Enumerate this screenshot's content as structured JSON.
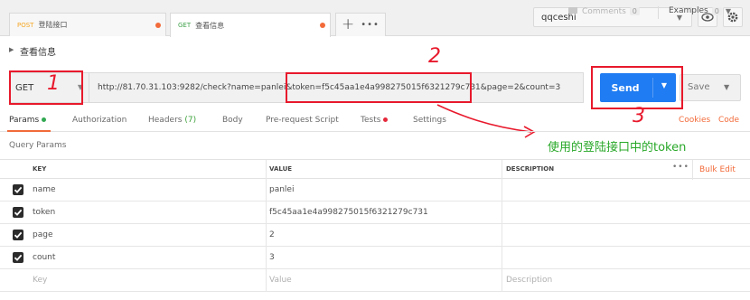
{
  "tabs": [
    {
      "method": "POST",
      "name": "登陆接口",
      "method_color": "#f5a623"
    },
    {
      "method": "GET",
      "name": "查看信息",
      "method_color": "#3fa14a"
    }
  ],
  "tab_controls": {
    "plus": "+",
    "more": "•••"
  },
  "environment": {
    "selected": "qqceshi"
  },
  "request": {
    "title": "查看信息",
    "method": "GET",
    "url": "http://81.70.31.103:9282/check?name=panlei&token=f5c45aa1e4a998275015f6321279c731&page=2&count=3"
  },
  "meta": {
    "comments_label": "Comments",
    "comments_count": "0",
    "examples_label": "Examples",
    "examples_count": "0"
  },
  "buttons": {
    "send": "Send",
    "save": "Save"
  },
  "subtabs": {
    "params": "Params",
    "authorization": "Authorization",
    "headers": "Headers",
    "headers_count": "(7)",
    "body": "Body",
    "prerequest": "Pre-request Script",
    "tests": "Tests",
    "settings": "Settings",
    "cookies": "Cookies",
    "code": "Code"
  },
  "query_params_title": "Query Params",
  "table": {
    "headers": {
      "key": "KEY",
      "value": "VALUE",
      "description": "DESCRIPTION"
    },
    "bulk_edit": "Bulk Edit",
    "more": "•••",
    "rows": [
      {
        "key": "name",
        "value": "panlei",
        "description": ""
      },
      {
        "key": "token",
        "value": "f5c45aa1e4a998275015f6321279c731",
        "description": ""
      },
      {
        "key": "page",
        "value": "2",
        "description": ""
      },
      {
        "key": "count",
        "value": "3",
        "description": ""
      }
    ],
    "placeholder": {
      "key": "Key",
      "value": "Value",
      "description": "Description"
    }
  },
  "annotations": {
    "n1": "1",
    "n2": "2",
    "n3": "3",
    "note": "使用的登陆接口中的token",
    "color": "#e8192c",
    "note_color": "#28a828"
  },
  "colors": {
    "accent": "#f26b3a",
    "send_bg": "#1f7cf2"
  }
}
